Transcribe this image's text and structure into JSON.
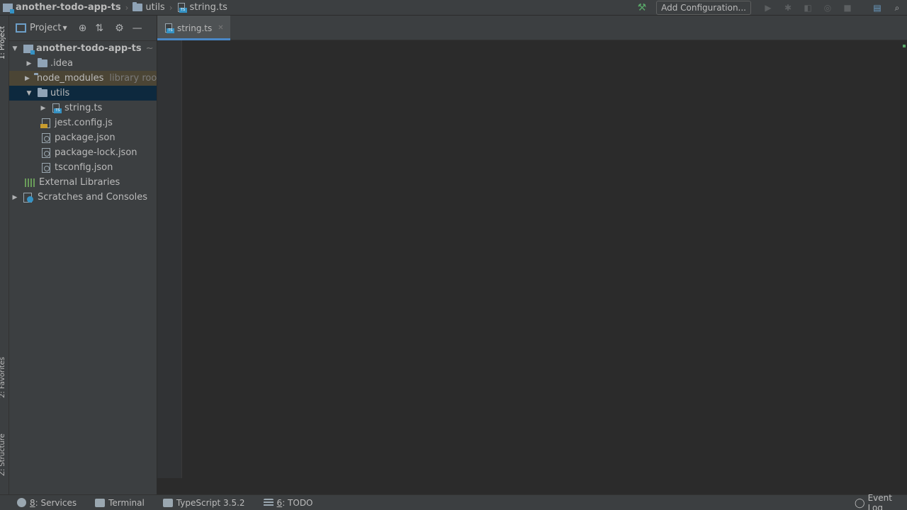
{
  "breadcrumbs": {
    "project": "another-todo-app-ts",
    "folder": "utils",
    "file": "string.ts"
  },
  "toolbar": {
    "add_configuration": "Add Configuration..."
  },
  "left_strip": {
    "project": "1: Project",
    "favorites": "2: Favorites",
    "structure": "Z: Structure"
  },
  "project_panel": {
    "title": "Project",
    "tree": {
      "root": "another-todo-app-ts",
      "root_suffix": "~",
      "idea": ".idea",
      "node_modules": "node_modules",
      "node_modules_hint": "library root",
      "utils": "utils",
      "string_ts": "string.ts",
      "jest_config": "jest.config.js",
      "package_json": "package.json",
      "package_lock": "package-lock.json",
      "tsconfig": "tsconfig.json",
      "external_libraries": "External Libraries",
      "scratches": "Scratches and Consoles"
    }
  },
  "editor": {
    "tab_label": "string.ts",
    "content": ""
  },
  "bottom_bar": {
    "services_num": "8",
    "services": ": Services",
    "terminal": "Terminal",
    "typescript": "TypeScript 3.5.2",
    "todo_num": "6",
    "todo": ": TODO",
    "event_log": "Event Log"
  },
  "colors": {
    "background": "#2b2b2b",
    "panel": "#3c3f41",
    "selection": "#0d293e",
    "accent": "#4a88c7",
    "typescript_badge": "#3592c4"
  }
}
